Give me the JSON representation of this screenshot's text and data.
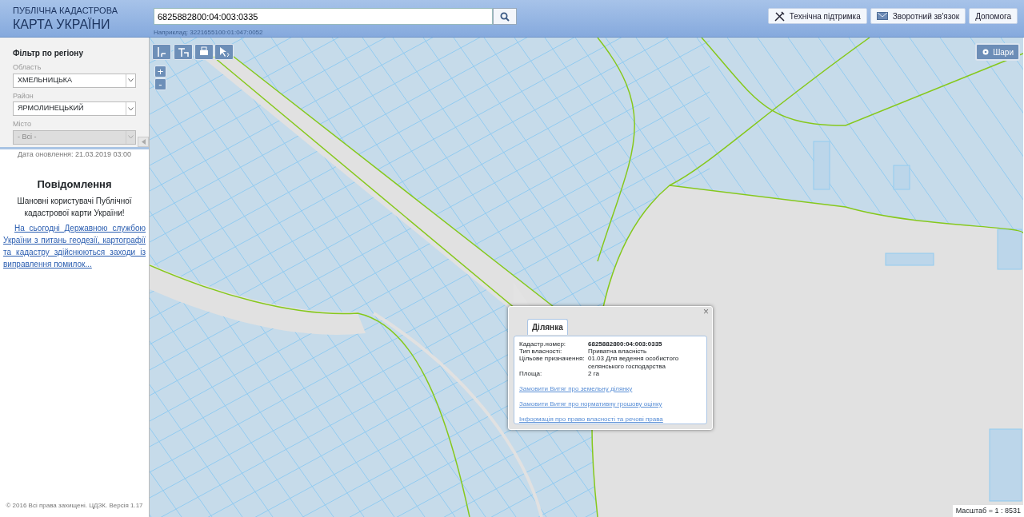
{
  "header": {
    "logo_line1": "ПУБЛІЧНА КАДАСТРОВА",
    "logo_line2": "КАРТА УКРАЇНИ",
    "search": {
      "value": "6825882800:04:003:0335"
    },
    "search_hint": "Наприклад: 3221655100:01:047:0052",
    "buttons": [
      {
        "label": "Технічна підтримка",
        "kind": "tools"
      },
      {
        "label": "Зворотний зв'язок",
        "kind": "mail"
      },
      {
        "label": "Допомога",
        "kind": "plain"
      }
    ]
  },
  "sidebar": {
    "title": "Фільтр по регіону",
    "fields": [
      {
        "label": "Область",
        "value": "ХМЕЛЬНИЦЬКА",
        "disabled": false
      },
      {
        "label": "Район",
        "value": "ЯРМОЛИНЕЦЬКИЙ",
        "disabled": false
      },
      {
        "label": "Місто",
        "value": "- Всі -",
        "disabled": true
      }
    ],
    "update_date": "Дата оновлення: 21.03.2019 03:00",
    "notice_title": "Повідомлення",
    "notice_text": "Шановні користувачі Публічної кадастрової карти України!",
    "notice_link": "На сьогодні Державною службою України з питань геодезії, картографії та кадастру здійснюються заходи із виправлення помилок...",
    "footer": "© 2016 Всі права захищені. ЦДЗК. Версія 1.17"
  },
  "map": {
    "tools": [
      {
        "kind": "ruler"
      },
      {
        "kind": "area"
      },
      {
        "kind": "print"
      },
      {
        "kind": "info"
      }
    ],
    "zoom_in": "+",
    "zoom_out": "-",
    "layers_button": "Шари",
    "scale": "Масштаб = 1 : 8531",
    "popup": {
      "close": "×",
      "tabs": [
        {
          "label": "Ділянка",
          "selected": true
        }
      ],
      "rows": [
        {
          "label": "Кадастр.номер:",
          "value": "6825882800:04:003:0335",
          "bold": true
        },
        {
          "label": "Тип власності:",
          "value": "Приватна власність",
          "bold": false
        },
        {
          "label": "Цільове призначення:",
          "value": "01.03 Для ведення особистого селянського господарства",
          "bold": false
        },
        {
          "label": "Площа:",
          "value": "2 га",
          "bold": false
        }
      ],
      "links": [
        "Замовити Витяг про земельну ділянку",
        "Замовити Витяг про нормативну грошову оцінку",
        "Інформація про право власності та речові права"
      ]
    }
  }
}
